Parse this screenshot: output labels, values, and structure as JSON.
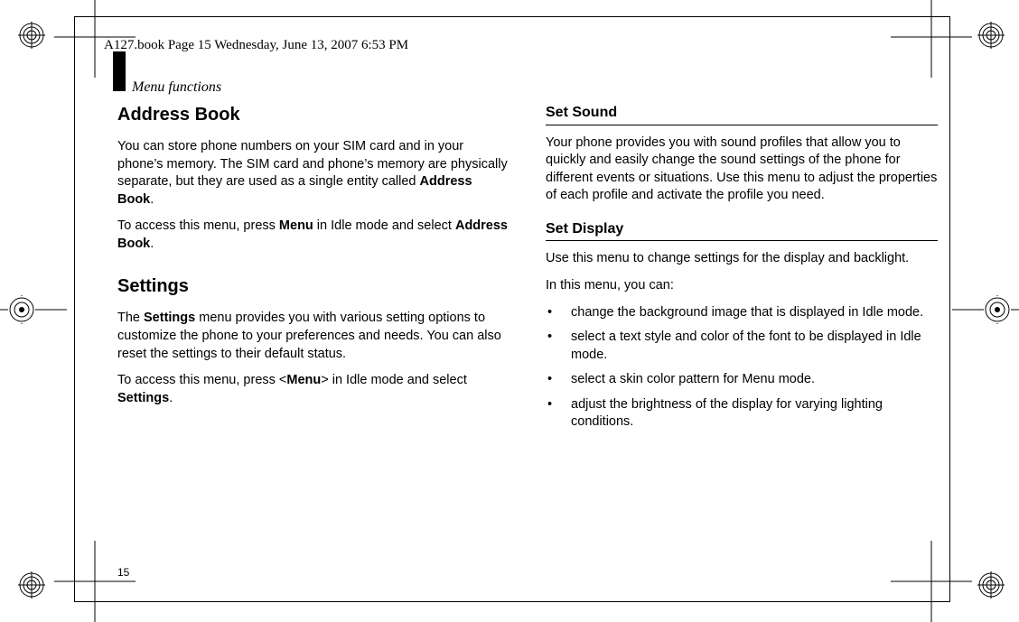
{
  "header": "A127.book  Page 15  Wednesday, June 13, 2007  6:53 PM",
  "section_label": "Menu functions",
  "page_number": "15",
  "left": {
    "h_address": "Address Book",
    "p_addr_1_pre": "You can store phone numbers on your SIM card and in your phone’s memory. The SIM card and phone’s memory are physically separate, but they are used as a single entity called ",
    "p_addr_1_bold": "Address Book",
    "p_addr_1_post": ".",
    "p_addr_2_pre": "To access this menu, press ",
    "p_addr_2_bold": "Menu",
    "p_addr_2_mid": " in Idle mode and select ",
    "p_addr_2_bold2": "Address Book",
    "p_addr_2_post": ".",
    "h_settings": "Settings",
    "p_set_1_pre": "The ",
    "p_set_1_bold": "Settings",
    "p_set_1_post": " menu provides you with various setting options to customize the phone to your preferences and needs. You can also reset the settings to their default status.",
    "p_set_2_pre": "To access this menu, press <",
    "p_set_2_bold": "Menu",
    "p_set_2_mid": "> in Idle mode and select ",
    "p_set_2_bold2": "Settings",
    "p_set_2_post": "."
  },
  "right": {
    "h_sound": "Set Sound",
    "p_sound": "Your phone provides you with sound profiles that allow you to quickly and easily change the sound settings of the phone for different events or situations. Use this menu to adjust the properties of each profile and activate the profile you need.",
    "h_display": "Set Display",
    "p_disp_intro": "Use this menu to change settings for the display and backlight.",
    "p_disp_lead": "In this menu, you can:",
    "bullets": [
      "change the background image that is displayed in Idle mode.",
      "select a text style and color of the font to be displayed in Idle mode.",
      "select a skin color pattern for Menu mode.",
      "adjust the brightness of the display for varying lighting conditions."
    ]
  }
}
